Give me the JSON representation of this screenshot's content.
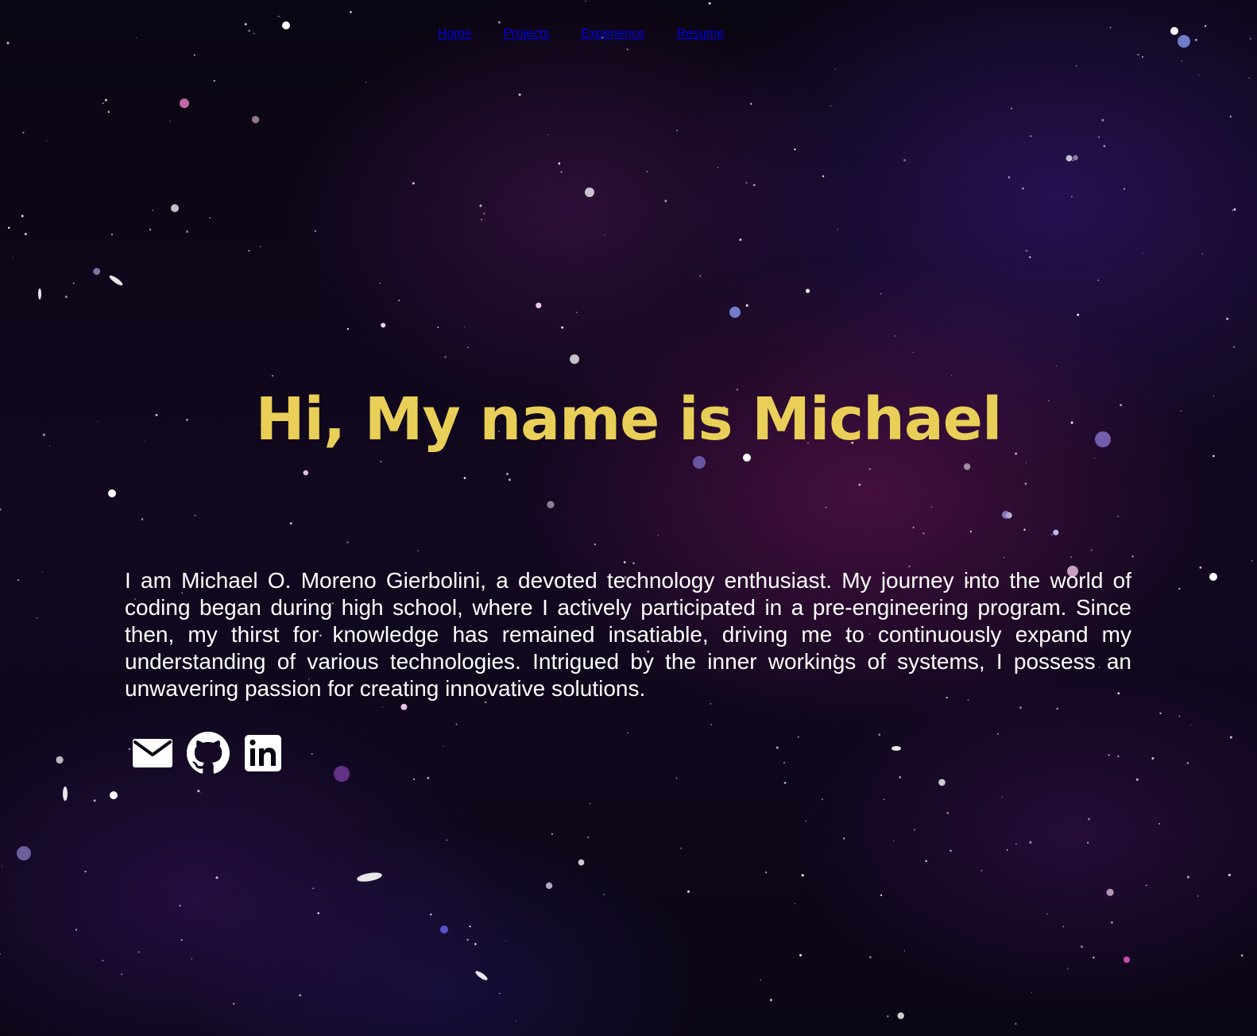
{
  "nav": {
    "items": [
      {
        "label": "Home"
      },
      {
        "label": "Projects"
      },
      {
        "label": "Experience"
      },
      {
        "label": "Resume"
      }
    ]
  },
  "hero": {
    "title": "Hi, My name is Michael"
  },
  "about": {
    "text": "I am Michael O. Moreno Gierbolini, a devoted technology enthusiast. My journey into the world of coding began during high school, where I actively participated in a pre-engineering program. Since then, my thirst for knowledge has remained insatiable, driving me to continuously expand my understanding of various technologies. Intrigued by the inner workings of systems, I possess an unwavering passion for creating innovative solutions."
  },
  "socials": [
    {
      "icon": "mail-icon"
    },
    {
      "icon": "github-icon"
    },
    {
      "icon": "linkedin-icon"
    }
  ],
  "colors": {
    "accent": "#e9cf57",
    "text": "#ffffff",
    "background": "#07030f"
  }
}
